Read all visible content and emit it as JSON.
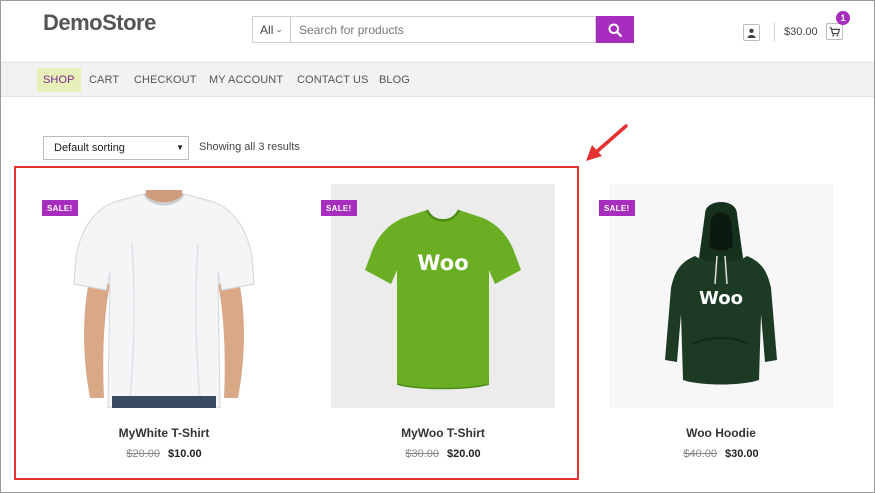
{
  "header": {
    "logo": "DemoStore",
    "search": {
      "category": "All",
      "placeholder": "Search for products"
    },
    "cart": {
      "total": "$30.00",
      "count": "1"
    }
  },
  "nav": {
    "items": [
      {
        "label": "SHOP",
        "active": true
      },
      {
        "label": "CART"
      },
      {
        "label": "CHECKOUT"
      },
      {
        "label": "MY ACCOUNT"
      },
      {
        "label": "CONTACT US"
      },
      {
        "label": "BLOG"
      }
    ]
  },
  "toolbar": {
    "sorting": "Default sorting",
    "result_count": "Showing all 3 results"
  },
  "products": [
    {
      "badge": "SALE!",
      "name": "MyWhite T-Shirt",
      "old_price": "$20.00",
      "price": "$10.00"
    },
    {
      "badge": "SALE!",
      "name": "MyWoo T-Shirt",
      "old_price": "$30.00",
      "price": "$20.00",
      "print": "Woo"
    },
    {
      "badge": "SALE!",
      "name": "Woo Hoodie",
      "old_price": "$40.00",
      "price": "$30.00",
      "print": "Woo"
    }
  ],
  "colors": {
    "accent": "#a62dbd",
    "nav_active_bg": "#e7f0b9",
    "highlight": "#e5312f",
    "green_shirt": "#6aae24",
    "hoodie": "#1c3a24"
  },
  "icons": {
    "search": "search-icon",
    "account": "user-icon",
    "cart": "cart-icon"
  }
}
